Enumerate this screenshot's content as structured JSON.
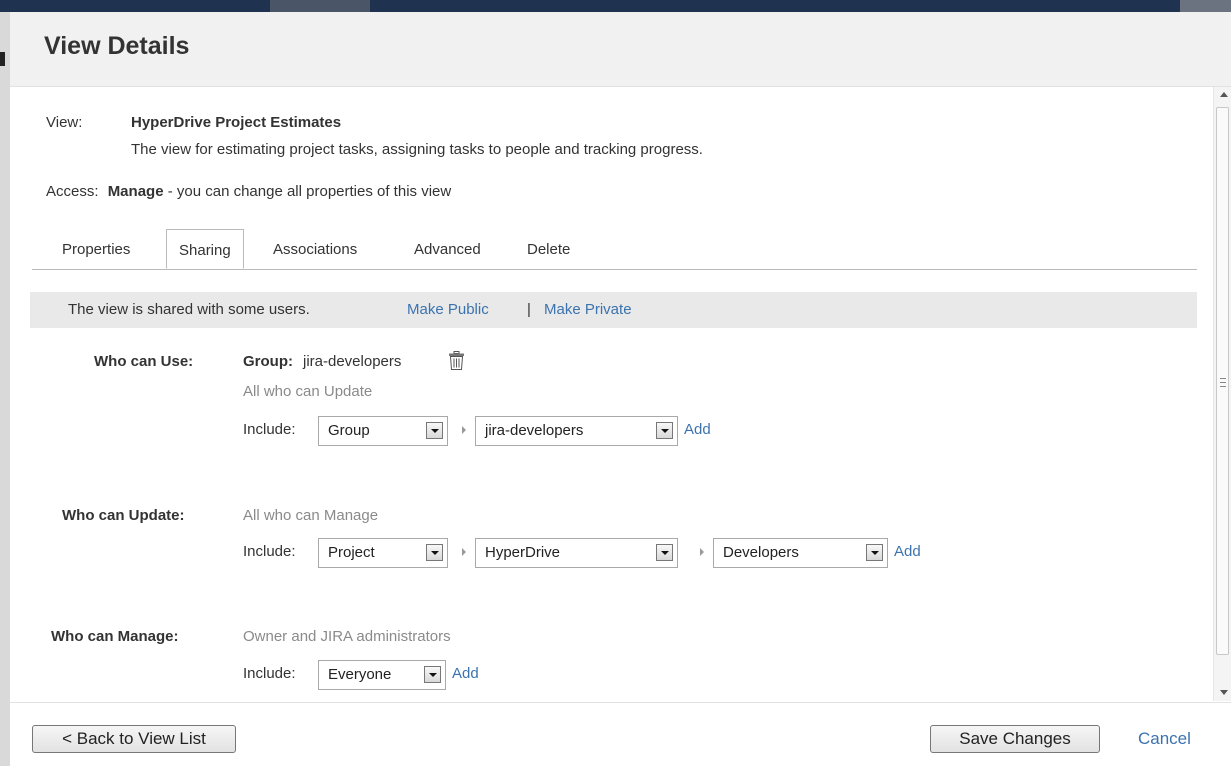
{
  "dialog": {
    "title": "View Details"
  },
  "view": {
    "label": "View:",
    "name": "HyperDrive Project Estimates",
    "description": "The view for estimating project tasks, assigning tasks to people and tracking progress."
  },
  "access": {
    "label": "Access:",
    "level": "Manage",
    "description": "- you can change all properties of this view"
  },
  "tabs": [
    {
      "label": "Properties",
      "active": false
    },
    {
      "label": "Sharing",
      "active": true
    },
    {
      "label": "Associations",
      "active": false
    },
    {
      "label": "Advanced",
      "active": false
    },
    {
      "label": "Delete",
      "active": false
    }
  ],
  "sharing": {
    "status": "The view is shared with some users.",
    "make_public": "Make Public",
    "separator": "|",
    "make_private": "Make Private"
  },
  "use": {
    "label": "Who can Use:",
    "group_label": "Group:",
    "group_value": "jira-developers",
    "inherited": "All who can Update",
    "include_label": "Include:",
    "type_select": "Group",
    "value_select": "jira-developers",
    "add": "Add"
  },
  "update": {
    "label": "Who can Update:",
    "inherited": "All who can Manage",
    "include_label": "Include:",
    "type_select": "Project",
    "project_select": "HyperDrive",
    "role_select": "Developers",
    "add": "Add"
  },
  "manage": {
    "label": "Who can Manage:",
    "inherited": "Owner and JIRA administrators",
    "include_label": "Include:",
    "type_select": "Everyone",
    "add": "Add"
  },
  "footer": {
    "back": "< Back to View List",
    "save": "Save Changes",
    "cancel": "Cancel"
  },
  "icons": {
    "delete_group": "trash-icon"
  },
  "colors": {
    "link": "#3b73af",
    "header_bg": "#f1f1f1",
    "infobar_bg": "#e9e9e9"
  }
}
